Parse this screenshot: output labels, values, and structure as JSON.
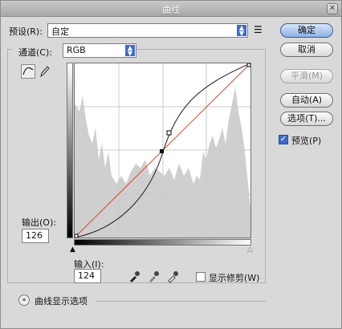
{
  "window": {
    "title": "曲线"
  },
  "preset": {
    "label": "预设(R):",
    "value": "自定"
  },
  "channel": {
    "label": "通道(C):",
    "value": "RGB"
  },
  "buttons": {
    "ok": "确定",
    "cancel": "取消",
    "smooth": "平滑(M)",
    "auto": "自动(A)",
    "options": "选项(T)..."
  },
  "preview": {
    "label": "预览(P)",
    "checked": true
  },
  "output": {
    "label": "输出(O):",
    "value": "126"
  },
  "input": {
    "label": "输入(I):",
    "value": "124"
  },
  "clipping": {
    "label": "显示修剪(W)",
    "checked": false
  },
  "display_options": {
    "label": "曲线显示选项"
  },
  "icons": [
    "menu-icon",
    "curve-tool-icon",
    "pencil-icon",
    "eyedropper-black-icon",
    "eyedropper-gray-icon",
    "eyedropper-white-icon",
    "close-icon",
    "expand-icon"
  ],
  "colors": {
    "primary_button": "#8fb0e3",
    "dropdown_arrow": "#3d6bc9",
    "diagonal": "#d9442e"
  }
}
